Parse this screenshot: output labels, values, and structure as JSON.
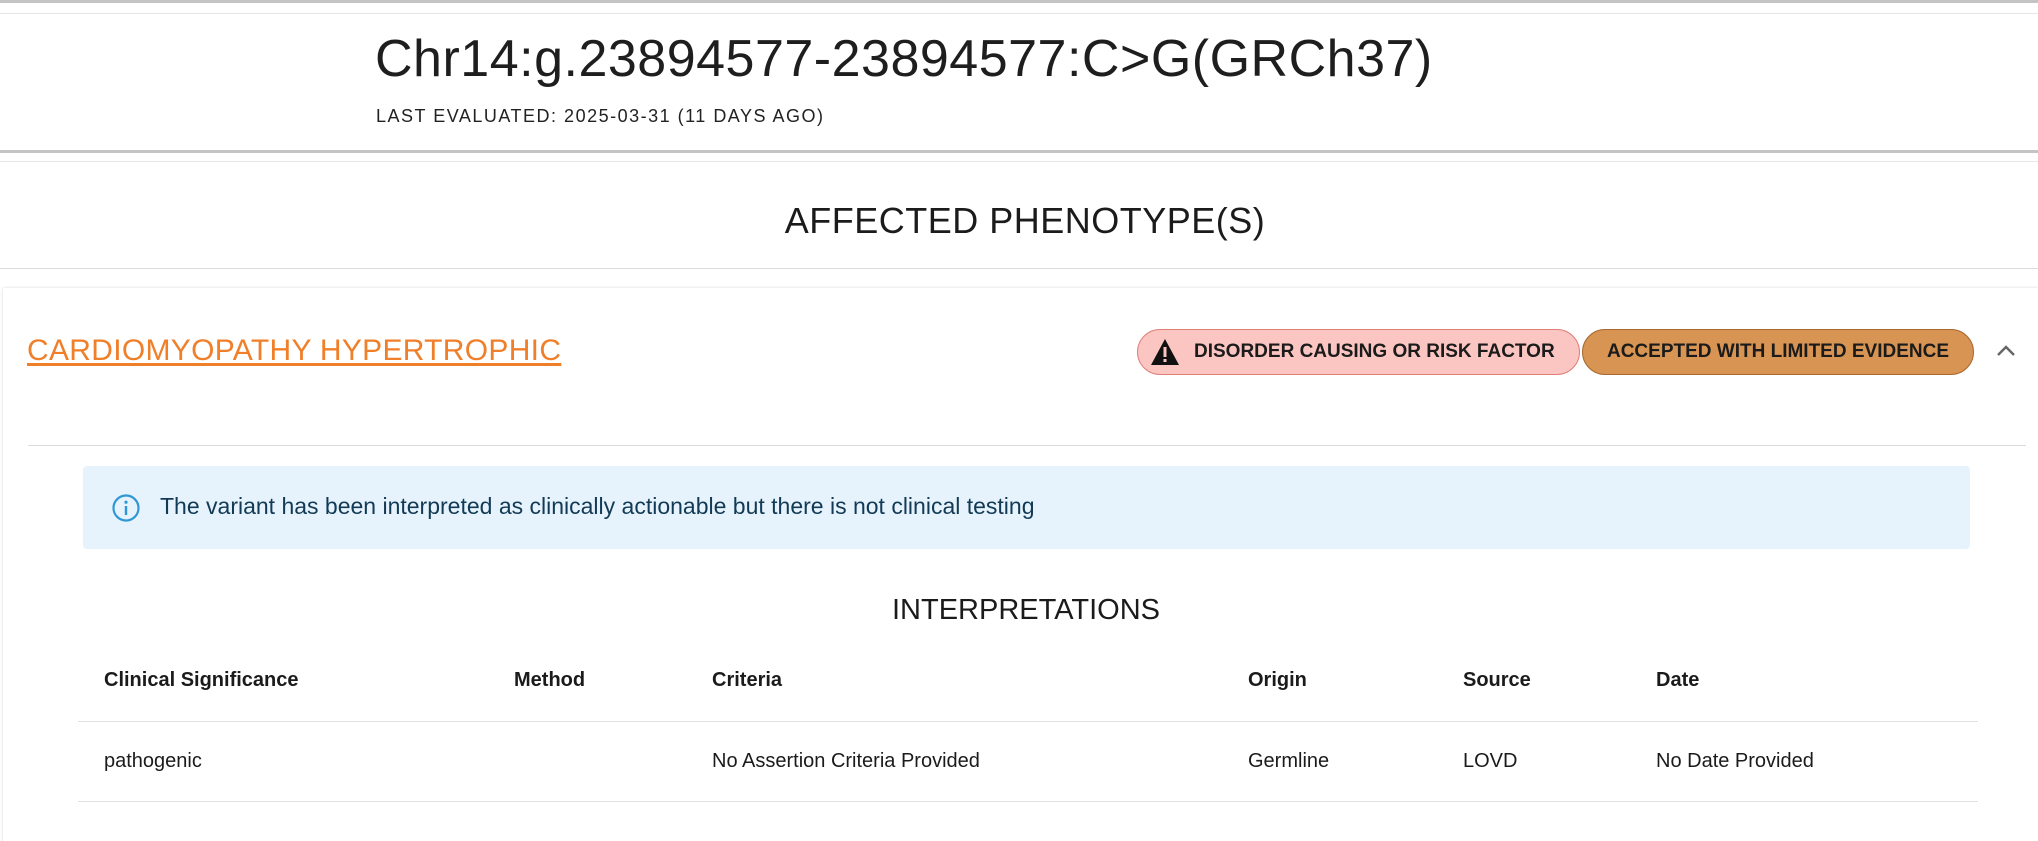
{
  "header": {
    "variant": "Chr14:g.23894577-23894577:C>G(GRCh37)",
    "last_evaluated": "LAST EVALUATED: 2025-03-31 (11 DAYS AGO)"
  },
  "phenotypes_section": {
    "title": "AFFECTED PHENOTYPE(S)",
    "items": [
      {
        "name": "CARDIOMYOPATHY HYPERTROPHIC",
        "chips": {
          "risk": "DISORDER CAUSING OR RISK FACTOR",
          "evidence": "ACCEPTED WITH LIMITED EVIDENCE"
        },
        "alert": "The variant has been interpreted as clinically actionable but there is not clinical testing",
        "interpretations": {
          "title": "INTERPRETATIONS",
          "columns": [
            "Clinical Significance",
            "Method",
            "Criteria",
            "Origin",
            "Source",
            "Date"
          ],
          "rows": [
            [
              "pathogenic",
              "",
              "No Assertion Criteria Provided",
              "Germline",
              "LOVD",
              "No Date Provided"
            ]
          ]
        }
      }
    ]
  },
  "icons": {
    "warning": "warning-triangle-icon",
    "info": "info-icon",
    "collapse": "chevron-up-icon"
  },
  "colors": {
    "link": "#f07f2a",
    "risk_chip_bg": "#fbc6c2",
    "evidence_chip_bg": "#d89453",
    "alert_bg": "#e6f3fc",
    "info_icon": "#2f97d6"
  }
}
